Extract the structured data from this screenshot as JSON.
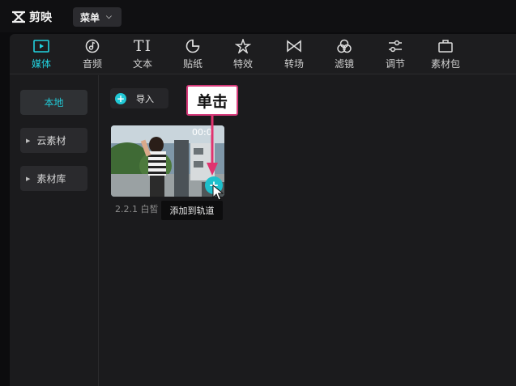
{
  "app": {
    "name": "剪映"
  },
  "topbar": {
    "menu_label": "菜单"
  },
  "toolbar": {
    "tabs": [
      {
        "label": "媒体",
        "icon": "media-icon",
        "active": true
      },
      {
        "label": "音频",
        "icon": "audio-icon"
      },
      {
        "label": "文本",
        "icon": "text-icon"
      },
      {
        "label": "贴纸",
        "icon": "sticker-icon"
      },
      {
        "label": "特效",
        "icon": "effects-icon"
      },
      {
        "label": "转场",
        "icon": "transition-icon"
      },
      {
        "label": "滤镜",
        "icon": "filter-icon"
      },
      {
        "label": "调节",
        "icon": "adjust-icon"
      },
      {
        "label": "素材包",
        "icon": "package-icon"
      }
    ],
    "text_glyph": "TI"
  },
  "sidebar": {
    "items": [
      {
        "label": "本地",
        "active": true
      },
      {
        "label": "云素材"
      },
      {
        "label": "素材库"
      }
    ]
  },
  "content": {
    "import_label": "导入",
    "clip": {
      "duration": "00:0",
      "name": "2.2.1  白皙"
    },
    "tooltip": "添加到轨道"
  },
  "annotation": {
    "text": "单击"
  },
  "colors": {
    "accent": "#21c9d6",
    "annotation_border": "#d63a7a",
    "arrow": "#e0336f"
  }
}
